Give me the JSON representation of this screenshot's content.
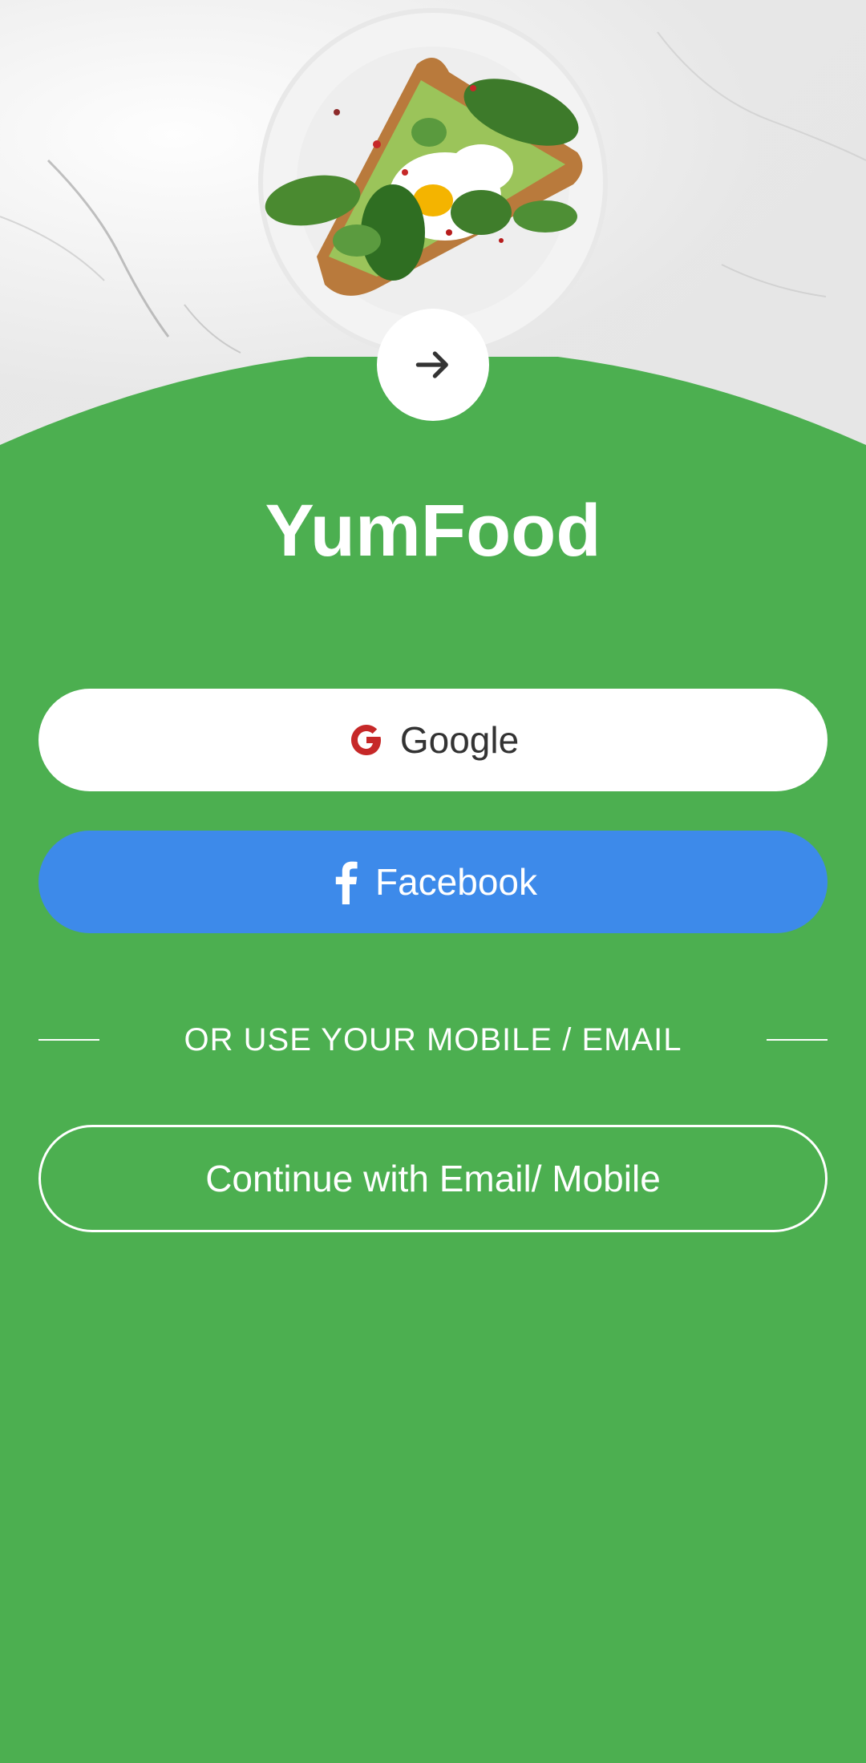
{
  "app": {
    "title": "YumFood"
  },
  "hero": {
    "image": "avocado-toast-plate-photo"
  },
  "actions": {
    "next_icon": "arrow-right-icon",
    "google_label": "Google",
    "google_icon": "google-icon",
    "facebook_label": "Facebook",
    "facebook_icon": "facebook-icon",
    "divider_text": "OR USE YOUR MOBILE / EMAIL",
    "email_label": "Continue with Email/ Mobile"
  },
  "colors": {
    "background_green": "#4CAF50",
    "facebook_blue": "#3D8AEA",
    "google_red": "#C62828",
    "white": "#FFFFFF"
  }
}
